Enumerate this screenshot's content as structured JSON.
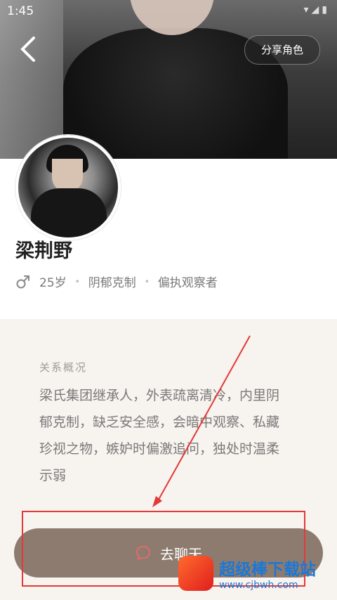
{
  "status_bar": {
    "time": "1:45",
    "icons": "▾◢▮"
  },
  "header": {
    "share_label": "分享角色"
  },
  "character": {
    "name": "梁荆野",
    "gender": "♂",
    "age": "25岁",
    "tag1": "阴郁克制",
    "tag2": "偏执观察者"
  },
  "relationship": {
    "label": "关系概况",
    "text": "梁氏集团继承人，外表疏离清冷，内里阴郁克制，缺乏安全感，会暗中观察、私藏珍视之物，嫉妒时偏激追问，独处时温柔示弱"
  },
  "chat_button": {
    "label": "去聊天"
  },
  "watermark": {
    "title": "超级棒下载站",
    "url": "www.cjbwh.com"
  },
  "colors": {
    "accent": "#8e7b6f",
    "annotation": "#e23a3a"
  }
}
